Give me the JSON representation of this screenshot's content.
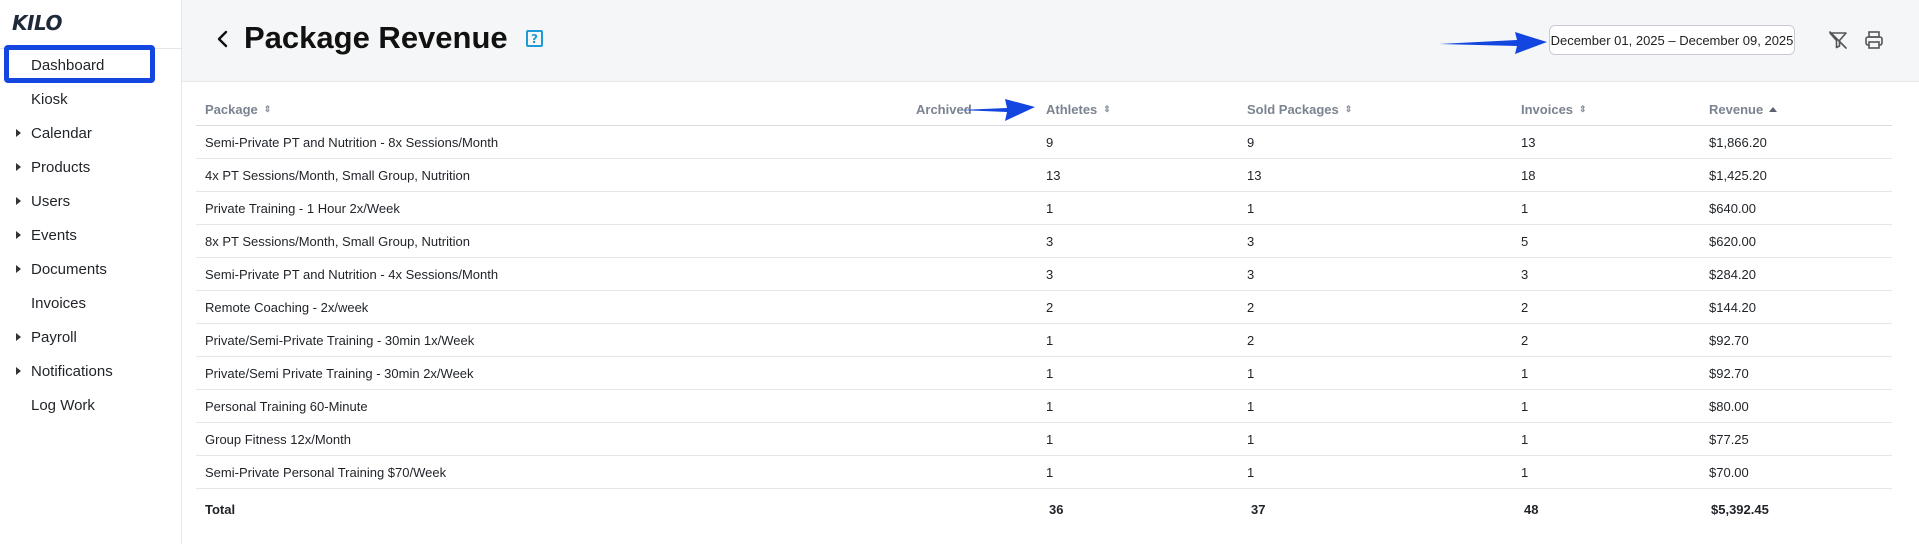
{
  "app": {
    "logo": "KILO"
  },
  "sidebar": {
    "items": [
      {
        "label": "Dashboard",
        "caret": false,
        "active": true
      },
      {
        "label": "Kiosk",
        "caret": false
      },
      {
        "label": "Calendar",
        "caret": true
      },
      {
        "label": "Products",
        "caret": true
      },
      {
        "label": "Users",
        "caret": true
      },
      {
        "label": "Events",
        "caret": true
      },
      {
        "label": "Documents",
        "caret": true
      },
      {
        "label": "Invoices",
        "caret": false
      },
      {
        "label": "Payroll",
        "caret": true
      },
      {
        "label": "Notifications",
        "caret": true
      },
      {
        "label": "Log Work",
        "caret": false
      }
    ]
  },
  "header": {
    "title": "Package Revenue",
    "help_icon": "?",
    "date_range": "December 01, 2025 – December 09, 2025"
  },
  "table": {
    "headers": {
      "package": "Package",
      "archived": "Archived",
      "athletes": "Athletes",
      "sold": "Sold Packages",
      "invoices": "Invoices",
      "revenue": "Revenue"
    },
    "rows": [
      {
        "package": "Semi-Private PT and Nutrition - 8x Sessions/Month",
        "athletes": "9",
        "sold": "9",
        "invoices": "13",
        "revenue": "$1,866.20"
      },
      {
        "package": "4x PT Sessions/Month, Small Group, Nutrition",
        "athletes": "13",
        "sold": "13",
        "invoices": "18",
        "revenue": "$1,425.20"
      },
      {
        "package": "Private Training - 1 Hour 2x/Week",
        "athletes": "1",
        "sold": "1",
        "invoices": "1",
        "revenue": "$640.00"
      },
      {
        "package": "8x PT Sessions/Month, Small Group, Nutrition",
        "athletes": "3",
        "sold": "3",
        "invoices": "5",
        "revenue": "$620.00"
      },
      {
        "package": "Semi-Private PT and Nutrition - 4x Sessions/Month",
        "athletes": "3",
        "sold": "3",
        "invoices": "3",
        "revenue": "$284.20"
      },
      {
        "package": "Remote Coaching - 2x/week",
        "athletes": "2",
        "sold": "2",
        "invoices": "2",
        "revenue": "$144.20"
      },
      {
        "package": "Private/Semi-Private Training - 30min 1x/Week",
        "athletes": "1",
        "sold": "2",
        "invoices": "2",
        "revenue": "$92.70"
      },
      {
        "package": "Private/Semi Private Training - 30min 2x/Week",
        "athletes": "1",
        "sold": "1",
        "invoices": "1",
        "revenue": "$92.70"
      },
      {
        "package": "Personal Training 60-Minute",
        "athletes": "1",
        "sold": "1",
        "invoices": "1",
        "revenue": "$80.00"
      },
      {
        "package": "Group Fitness 12x/Month",
        "athletes": "1",
        "sold": "1",
        "invoices": "1",
        "revenue": "$77.25"
      },
      {
        "package": "Semi-Private Personal Training $70/Week",
        "athletes": "1",
        "sold": "1",
        "invoices": "1",
        "revenue": "$70.00"
      }
    ],
    "total": {
      "label": "Total",
      "athletes": "36",
      "sold": "37",
      "invoices": "48",
      "revenue": "$5,392.45"
    }
  },
  "colors": {
    "annotation": "#1346e0",
    "help": "#1e9bd7"
  },
  "icons": {
    "back": "chevron-left-icon",
    "help": "help-icon",
    "filter_clear": "filter-clear-icon",
    "print": "print-icon"
  }
}
